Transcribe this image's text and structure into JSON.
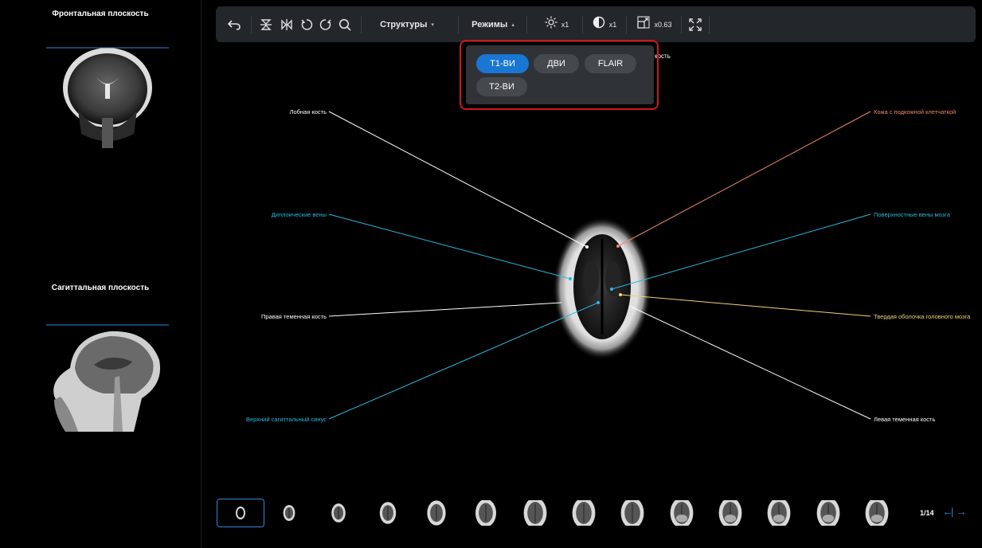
{
  "left_panel": {
    "frontal_title": "Фронтальная плоскость",
    "sagittal_title": "Сагиттальная плоскость"
  },
  "toolbar": {
    "structures_label": "Структуры",
    "modes_label": "Режимы",
    "brightness_value": "x1",
    "contrast_value": "x1",
    "zoom_value": "x0.63"
  },
  "modes_popup": {
    "options": [
      {
        "label": "Т1-ВИ",
        "active": true
      },
      {
        "label": "ДВИ",
        "active": false
      },
      {
        "label": "FLAIR",
        "active": false
      },
      {
        "label": "Т2-ВИ",
        "active": false
      }
    ],
    "partial_text": "кость"
  },
  "labels": {
    "frontal_bone": "Лобная кость",
    "skin": "Кожа с подкожной клетчаткой",
    "diploic_veins": "Диплоические вены",
    "superficial_veins": "Поверхностные вены мозга",
    "right_parietal": "Правая теменная кость",
    "dura": "Твердая оболочка головного мозга",
    "sag_sinus": "Верхний сагиттальный синус",
    "left_parietal": "Левая теменная кость"
  },
  "colors": {
    "white": "#ffffff",
    "cyan": "#2bb8e0",
    "orange": "#f0876a",
    "yellow": "#f2d27a",
    "accent": "#1976d2"
  },
  "pager": {
    "text": "1/14"
  }
}
